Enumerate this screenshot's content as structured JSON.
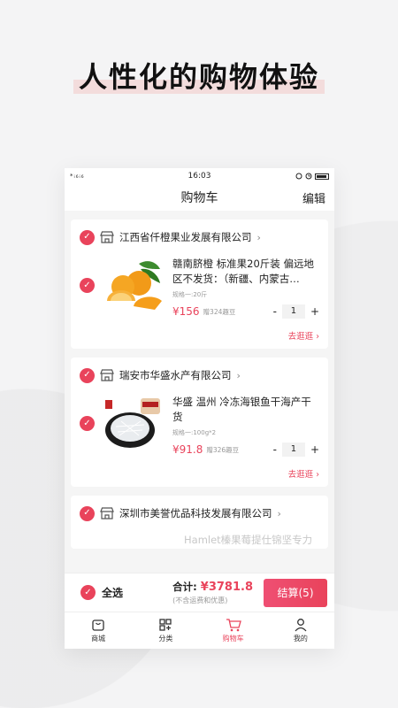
{
  "headline": "人性化的购物体验",
  "statusbar": {
    "signal": "*ᵢ₆ᵢ₆",
    "time": "16:03"
  },
  "nav": {
    "title": "购物车",
    "edit": "编辑"
  },
  "stores": [
    {
      "name": "江西省仟橙果业发展有限公司",
      "item": {
        "title": "赣南脐橙 标准果20斤装 偏远地区不发货：（新疆、内蒙古…",
        "spec": "规格一:20斤",
        "price": "¥156",
        "gift": "赠324趣豆",
        "qty": "1"
      },
      "go": "去逛逛 ›"
    },
    {
      "name": "瑞安市华盛水产有限公司",
      "item": {
        "title": "华盛 温州 冷冻海银鱼干海产干货",
        "spec": "规格一:100g*2",
        "price": "¥91.8",
        "gift": "赠326趣豆",
        "qty": "1"
      },
      "go": "去逛逛 ›"
    },
    {
      "name": "深圳市美誉优品科技发展有限公司",
      "partial_text": "Hamlet榛果莓提仕锦坚专力"
    }
  ],
  "checkout": {
    "select_all": "全选",
    "total_label": "合计:",
    "total": "¥3781.8",
    "note": "(不含运费和优惠)",
    "pay": "结算(5)"
  },
  "tabs": [
    {
      "label": "商城",
      "icon": "bag-icon"
    },
    {
      "label": "分类",
      "icon": "grid-icon"
    },
    {
      "label": "购物车",
      "icon": "cart-icon",
      "active": true
    },
    {
      "label": "我的",
      "icon": "user-icon"
    }
  ],
  "colors": {
    "accent": "#e9435b"
  }
}
